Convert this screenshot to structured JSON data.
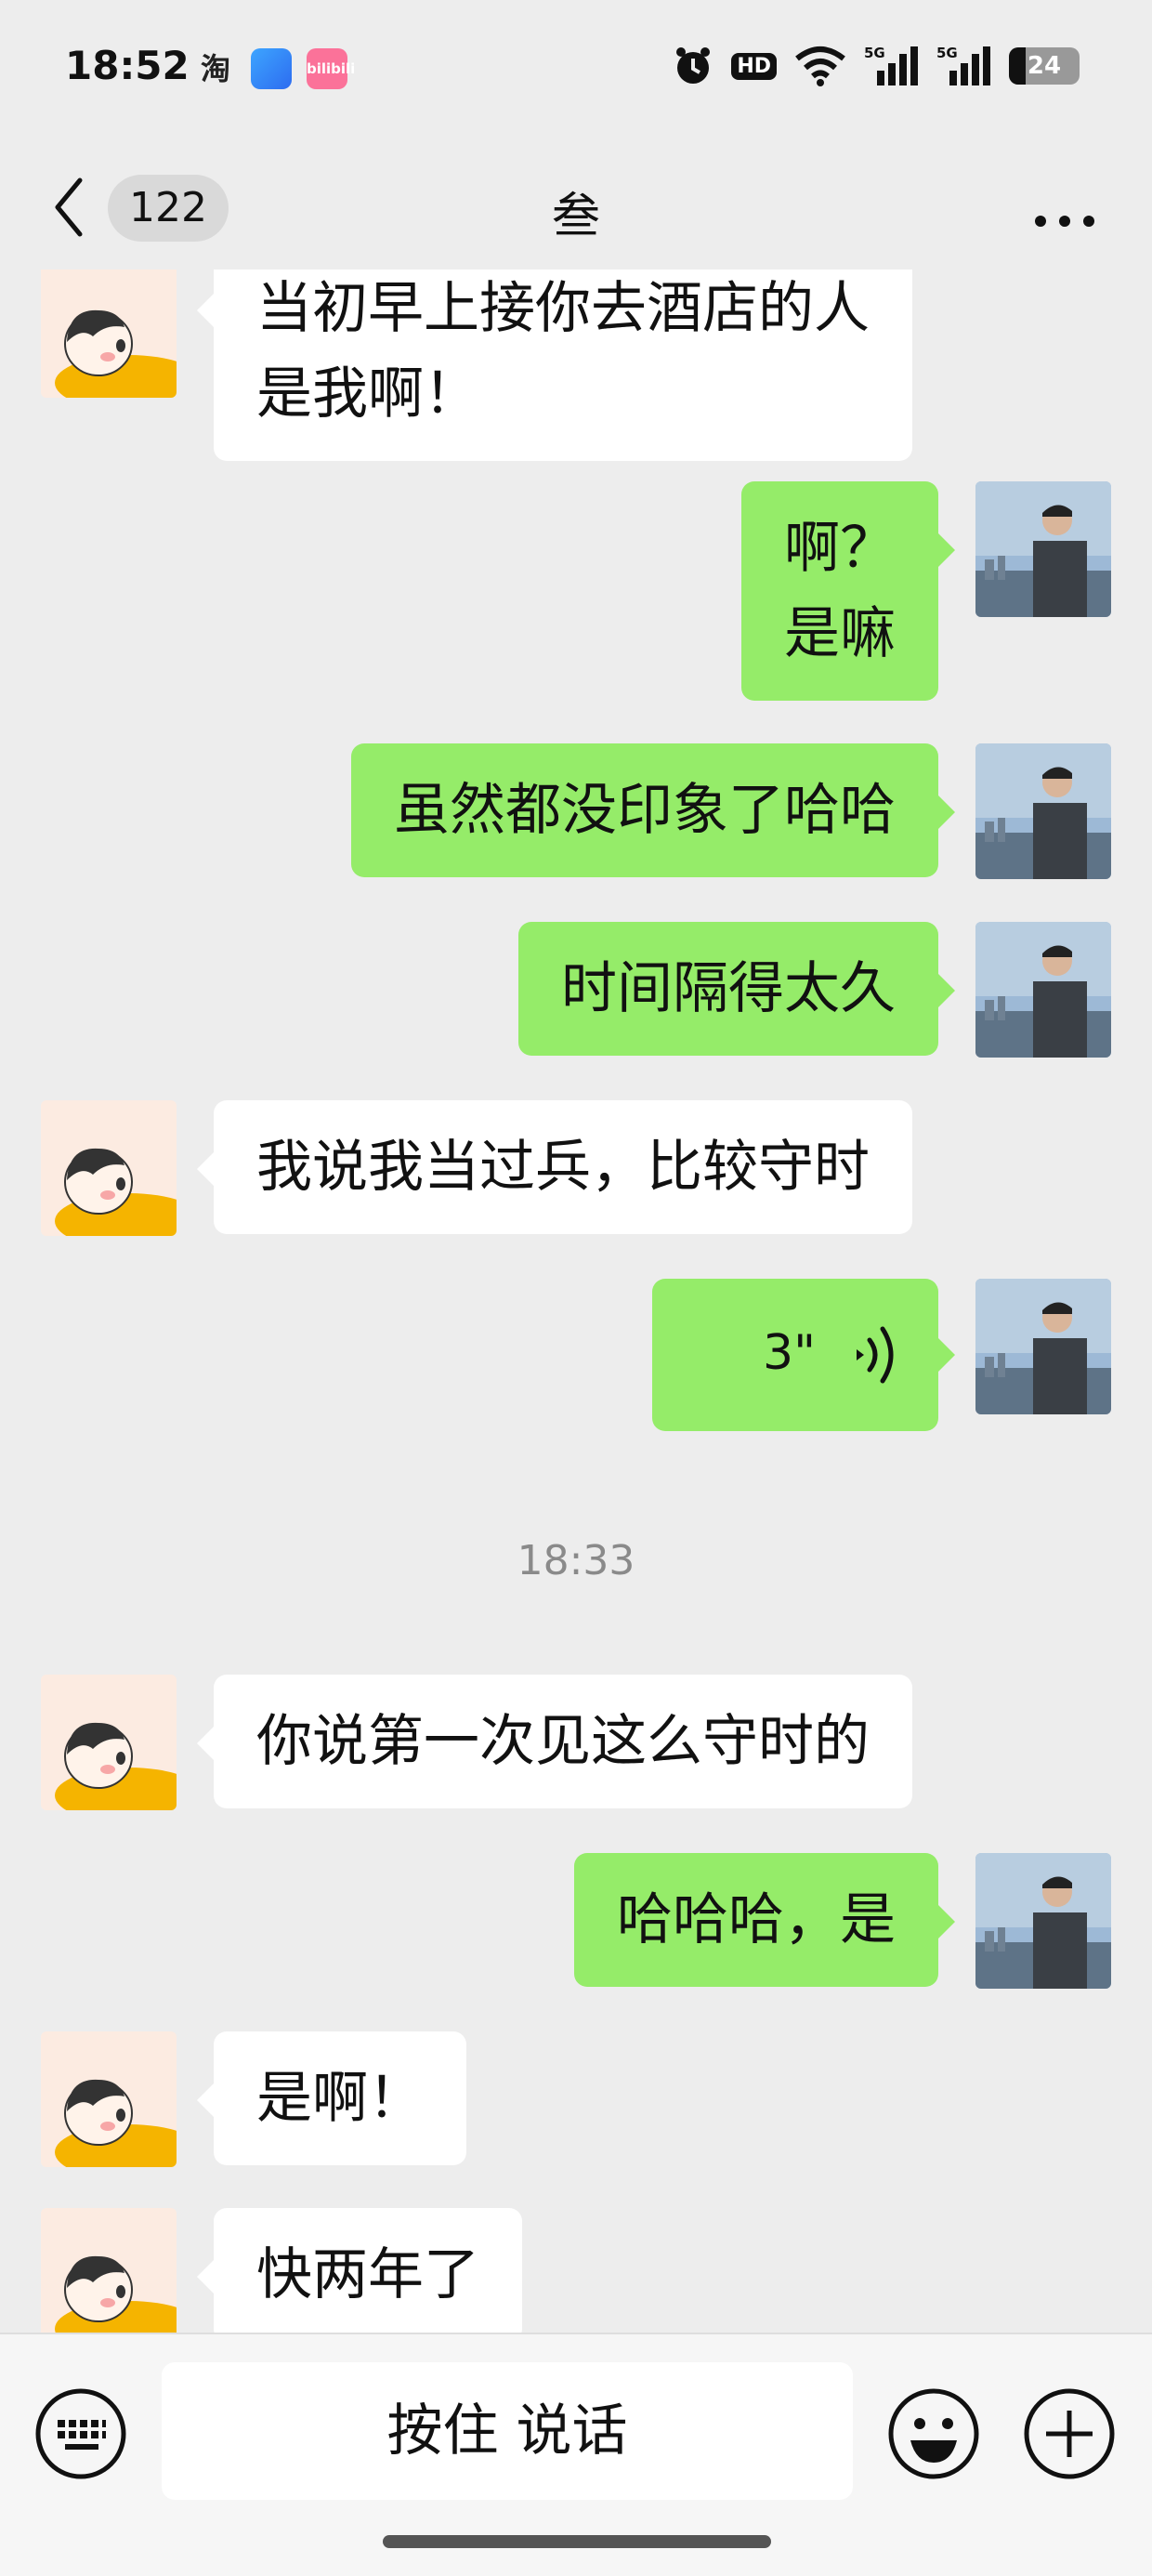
{
  "status_bar": {
    "time": "18:52",
    "app_icons": [
      "taobao-icon",
      "blue-app-icon",
      "bilibili-icon"
    ],
    "taobao_glyph": "淘",
    "bili_text": "bilibili",
    "hd_label": "HD",
    "network_1": "5G",
    "network_2": "5G",
    "battery": "24"
  },
  "header": {
    "back_icon": "chevron-left-icon",
    "unread_count": "122",
    "title": "叁",
    "more_icon": "more-dots-icon"
  },
  "messages": [
    {
      "side": "left",
      "text": "当初早上接你去酒店的人\n是我啊！"
    },
    {
      "side": "right",
      "text": "啊？\n是嘛"
    },
    {
      "side": "right",
      "text": "虽然都没印象了哈哈"
    },
    {
      "side": "right",
      "text": "时间隔得太久"
    },
    {
      "side": "left",
      "text": "我说我当过兵，比较守时"
    },
    {
      "side": "right",
      "type": "voice",
      "duration": "3\""
    },
    {
      "type": "timestamp",
      "text": "18:33"
    },
    {
      "side": "left",
      "text": "你说第一次见这么守时的"
    },
    {
      "side": "right",
      "text": "哈哈哈，是"
    },
    {
      "side": "left",
      "text": "是啊！"
    },
    {
      "side": "left",
      "text": "快两年了"
    }
  ],
  "input_bar": {
    "keyboard_icon": "keyboard-icon",
    "hold_to_talk_label": "按住 说话",
    "emoji_icon": "smiley-icon",
    "plus_icon": "plus-circle-icon"
  },
  "colors": {
    "background": "#EDEDED",
    "sent_bubble": "#95EC69",
    "received_bubble": "#FFFFFF",
    "timestamp_text": "#8A8A8A"
  }
}
